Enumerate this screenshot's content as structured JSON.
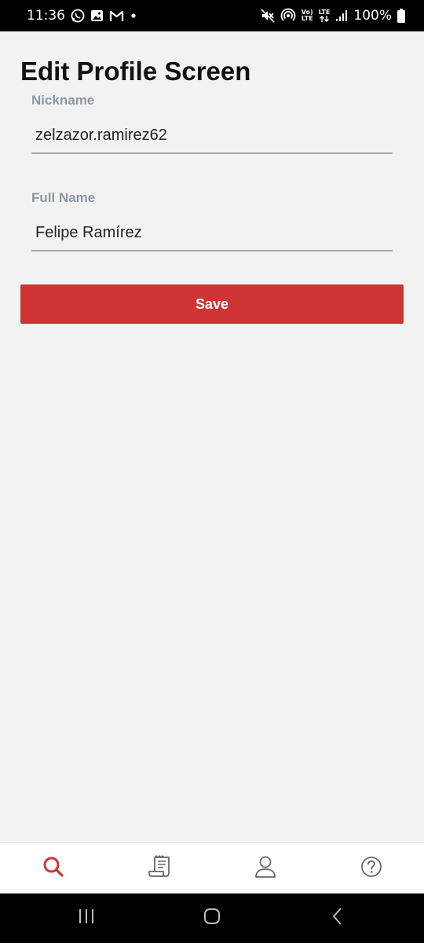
{
  "status_bar": {
    "time": "11:36",
    "battery_percent": "100%",
    "volte_label_top": "Vo)",
    "volte_label_bottom": "LTE",
    "lte_label": "LTE"
  },
  "screen": {
    "title": "Edit Profile Screen"
  },
  "form": {
    "nickname": {
      "label": "Nickname",
      "value": "zelzazor.ramirez62"
    },
    "full_name": {
      "label": "Full Name",
      "value": "Felipe Ramírez"
    },
    "save_label": "Save"
  },
  "tab_bar": {
    "items": [
      {
        "icon": "search-icon",
        "active": true
      },
      {
        "icon": "receipt-icon",
        "active": false
      },
      {
        "icon": "person-icon",
        "active": false
      },
      {
        "icon": "help-icon",
        "active": false
      }
    ]
  },
  "colors": {
    "accent": "#cd3535",
    "label": "#8e97a0",
    "inactive_icon": "#666666"
  },
  "nav_bar": {
    "items": [
      "recent-apps-icon",
      "home-icon",
      "back-icon"
    ]
  }
}
